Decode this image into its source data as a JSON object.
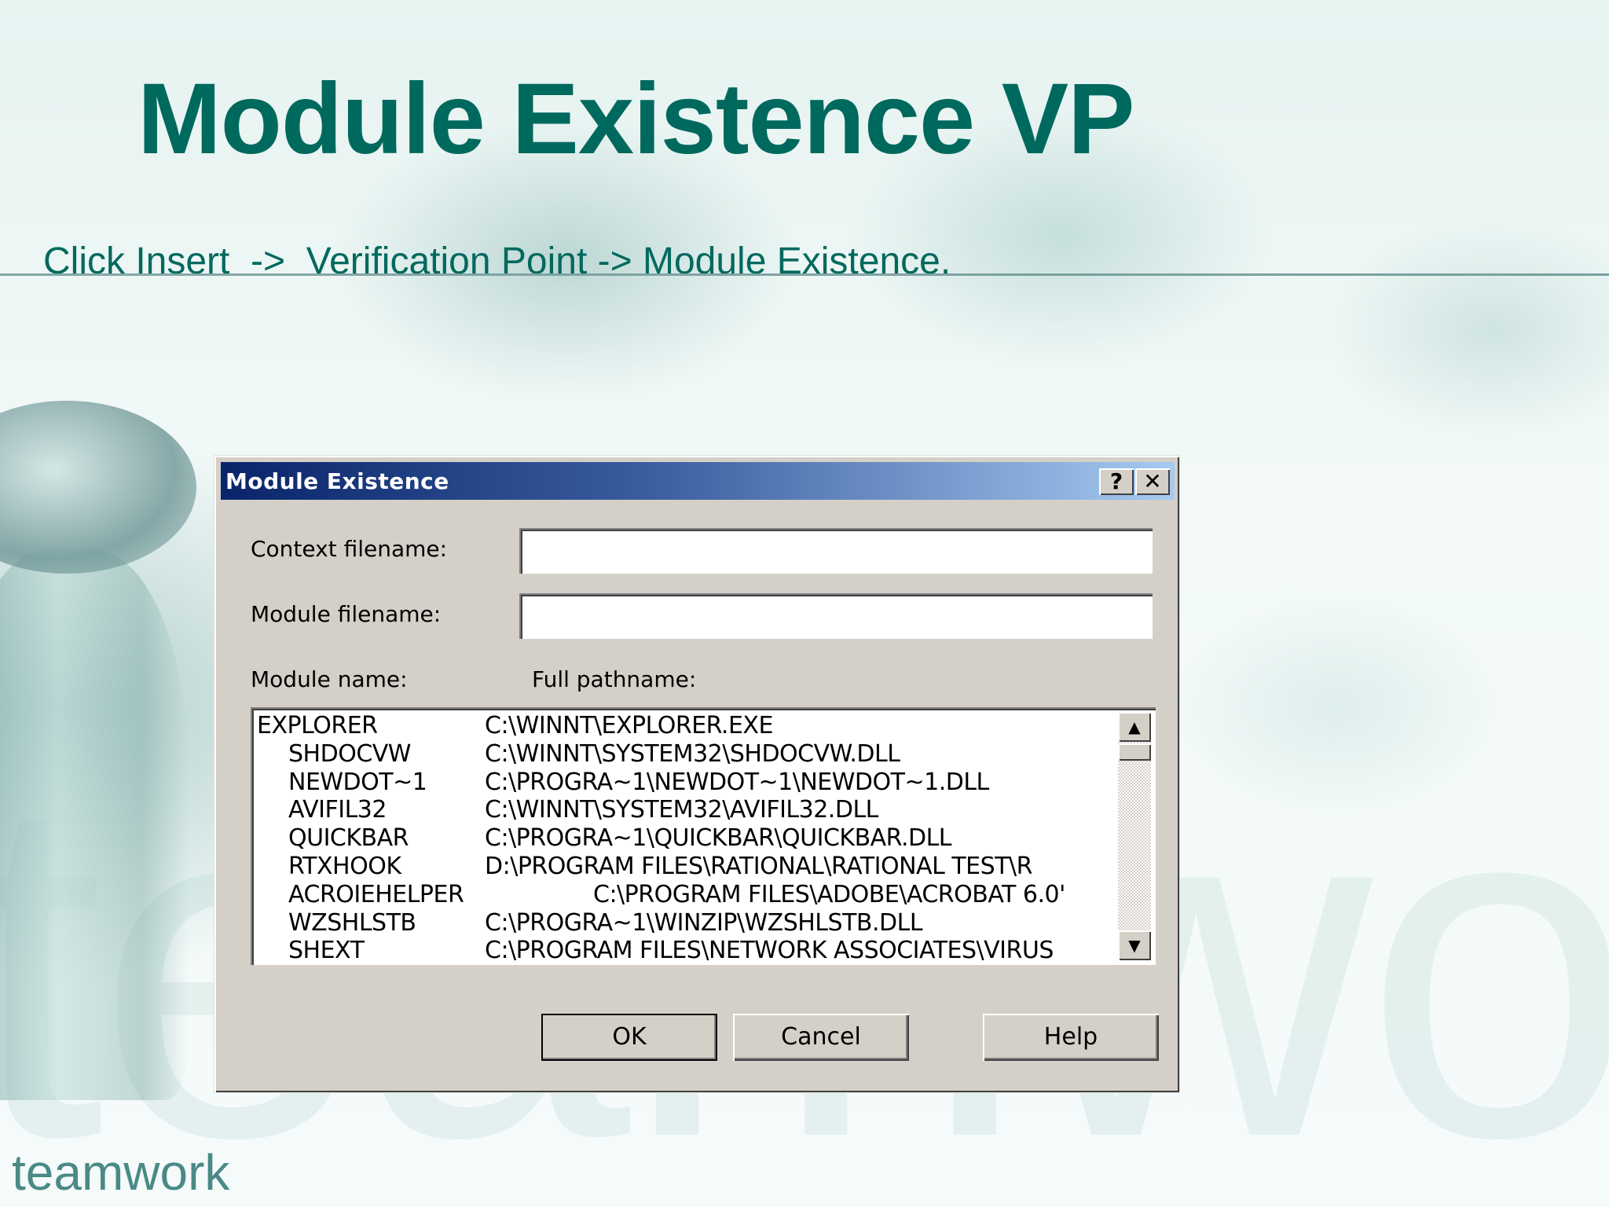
{
  "slide": {
    "title": "Module Existence VP",
    "instruction": "Click Insert  ->  Verification Point -> Module Existence.",
    "brand": "teamwork",
    "watermark": "teamwork"
  },
  "dialog": {
    "title": "Module Existence",
    "help_glyph": "?",
    "close_glyph": "✕",
    "context_label": "Context filename:",
    "context_value": "",
    "module_label": "Module filename:",
    "module_value": "",
    "col_module_name": "Module name:",
    "col_full_path": "Full pathname:",
    "rows": [
      {
        "name": "EXPLORER",
        "path": "C:\\WINNT\\EXPLORER.EXE"
      },
      {
        "name": "SHDOCVW",
        "path": "C:\\WINNT\\SYSTEM32\\SHDOCVW.DLL"
      },
      {
        "name": "NEWDOT~1",
        "path": "C:\\PROGRA~1\\NEWDOT~1\\NEWDOT~1.DLL"
      },
      {
        "name": "AVIFIL32",
        "path": "C:\\WINNT\\SYSTEM32\\AVIFIL32.DLL"
      },
      {
        "name": "QUICKBAR",
        "path": "C:\\PROGRA~1\\QUICKBAR\\QUICKBAR.DLL"
      },
      {
        "name": "RTXHOOK",
        "path": "D:\\PROGRAM FILES\\RATIONAL\\RATIONAL TEST\\R"
      },
      {
        "name": "ACROIEHELPER",
        "path": "C:\\PROGRAM FILES\\ADOBE\\ACROBAT 6.0'"
      },
      {
        "name": "WZSHLSTB",
        "path": "C:\\PROGRA~1\\WINZIP\\WZSHLSTB.DLL"
      },
      {
        "name": "SHEXT",
        "path": "C:\\PROGRAM FILES\\NETWORK ASSOCIATES\\VIRUS"
      }
    ],
    "ok_label": "OK",
    "cancel_label": "Cancel",
    "help_label": "Help"
  },
  "colors": {
    "title": "#00695e",
    "titlebar_start": "#0a246a",
    "titlebar_end": "#a6caf0",
    "dialog_face": "#d4d0c8"
  }
}
